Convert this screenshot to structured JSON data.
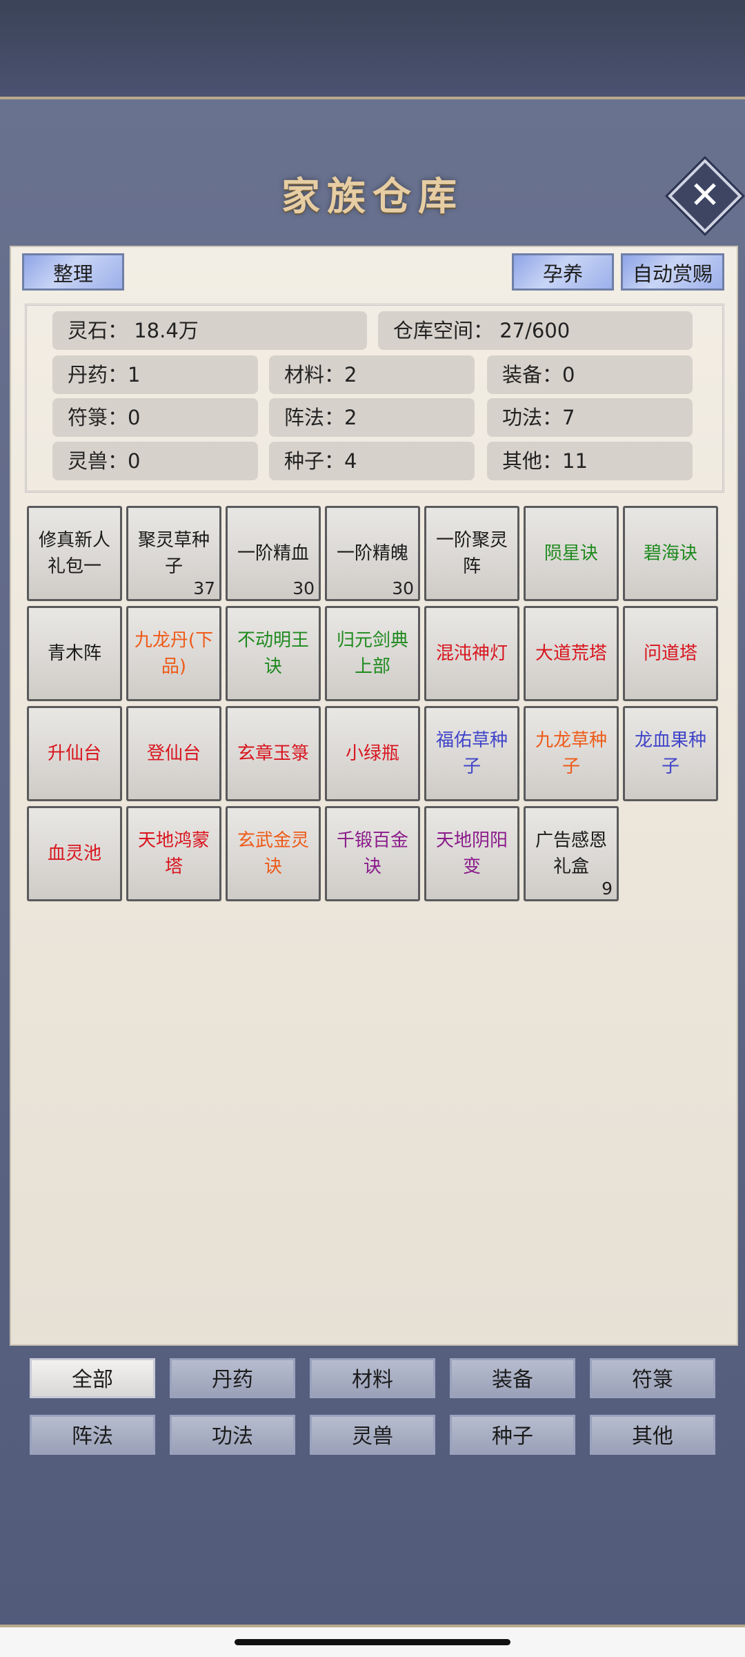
{
  "header": {
    "title": "家族仓库"
  },
  "toolbar": {
    "sort_label": "整理",
    "nurture_label": "孕养",
    "auto_reward_label": "自动赏赐"
  },
  "stats": {
    "spirit_stone": "灵石：  18.4万",
    "capacity": "仓库空间：    27/600",
    "pills": "丹药：1",
    "materials": "材料：2",
    "equipment": "装备：0",
    "talismans": "符箓：0",
    "formations": "阵法：2",
    "techniques": "功法：7",
    "beasts": "灵兽：0",
    "seeds": "种子：4",
    "others": "其他：11"
  },
  "items": [
    {
      "name": "修真新人礼包一",
      "count": "",
      "color": "#1a1a1a"
    },
    {
      "name": "聚灵草种子",
      "count": "37",
      "color": "#1a1a1a"
    },
    {
      "name": "一阶精血",
      "count": "30",
      "color": "#1a1a1a"
    },
    {
      "name": "一阶精魄",
      "count": "30",
      "color": "#1a1a1a"
    },
    {
      "name": "一阶聚灵阵",
      "count": "",
      "color": "#1a1a1a"
    },
    {
      "name": "陨星诀",
      "count": "",
      "color": "#1f8a1f"
    },
    {
      "name": "碧海诀",
      "count": "",
      "color": "#1f8a1f"
    },
    {
      "name": "青木阵",
      "count": "",
      "color": "#1a1a1a"
    },
    {
      "name": "九龙丹(下品)",
      "count": "",
      "color": "#ee5a18"
    },
    {
      "name": "不动明王诀",
      "count": "",
      "color": "#1f8a1f"
    },
    {
      "name": "归元剑典上部",
      "count": "",
      "color": "#1f8a1f"
    },
    {
      "name": "混沌神灯",
      "count": "",
      "color": "#d9141e"
    },
    {
      "name": "大道荒塔",
      "count": "",
      "color": "#d9141e"
    },
    {
      "name": "问道塔",
      "count": "",
      "color": "#d9141e"
    },
    {
      "name": "升仙台",
      "count": "",
      "color": "#d9141e"
    },
    {
      "name": "登仙台",
      "count": "",
      "color": "#d9141e"
    },
    {
      "name": "玄章玉箓",
      "count": "",
      "color": "#d9141e"
    },
    {
      "name": "小绿瓶",
      "count": "",
      "color": "#d9141e"
    },
    {
      "name": "福佑草种子",
      "count": "",
      "color": "#3f44c8"
    },
    {
      "name": "九龙草种子",
      "count": "",
      "color": "#ee5a18"
    },
    {
      "name": "龙血果种子",
      "count": "",
      "color": "#3f44c8"
    },
    {
      "name": "血灵池",
      "count": "",
      "color": "#d9141e"
    },
    {
      "name": "天地鸿蒙塔",
      "count": "",
      "color": "#d9141e"
    },
    {
      "name": "玄武金灵诀",
      "count": "",
      "color": "#ee5a18"
    },
    {
      "name": "千锻百金诀",
      "count": "",
      "color": "#8a1a8a"
    },
    {
      "name": "天地阴阳变",
      "count": "",
      "color": "#8a1a8a"
    },
    {
      "name": "广告感恩礼盒",
      "count": "9",
      "color": "#1a1a1a"
    }
  ],
  "tabs": [
    {
      "label": "全部",
      "active": true
    },
    {
      "label": "丹药",
      "active": false
    },
    {
      "label": "材料",
      "active": false
    },
    {
      "label": "装备",
      "active": false
    },
    {
      "label": "符箓",
      "active": false
    },
    {
      "label": "阵法",
      "active": false
    },
    {
      "label": "功法",
      "active": false
    },
    {
      "label": "灵兽",
      "active": false
    },
    {
      "label": "种子",
      "active": false
    },
    {
      "label": "其他",
      "active": false
    }
  ]
}
